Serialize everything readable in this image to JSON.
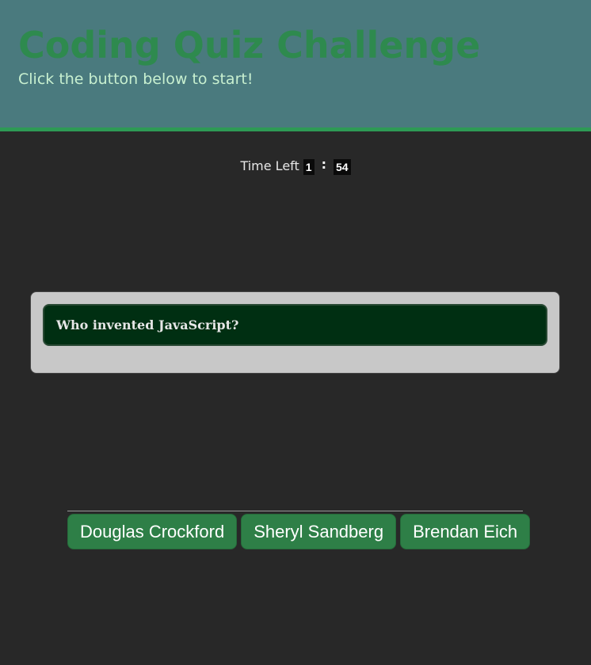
{
  "header": {
    "title": "Coding Quiz Challenge",
    "subtitle": "Click the button below to start!"
  },
  "timer": {
    "label": "Time Left",
    "minutes": "1",
    "separator": ":",
    "seconds": "54"
  },
  "question": {
    "text": "Who invented JavaScript?"
  },
  "answers": [
    {
      "label": "Douglas Crockford"
    },
    {
      "label": "Sheryl Sandberg"
    },
    {
      "label": "Brendan Eich"
    }
  ],
  "colors": {
    "header_bg": "#4a7a7e",
    "accent_green": "#2e9a55",
    "page_bg": "#282828",
    "button_bg": "#2e7f47",
    "question_bg": "#002f12"
  }
}
